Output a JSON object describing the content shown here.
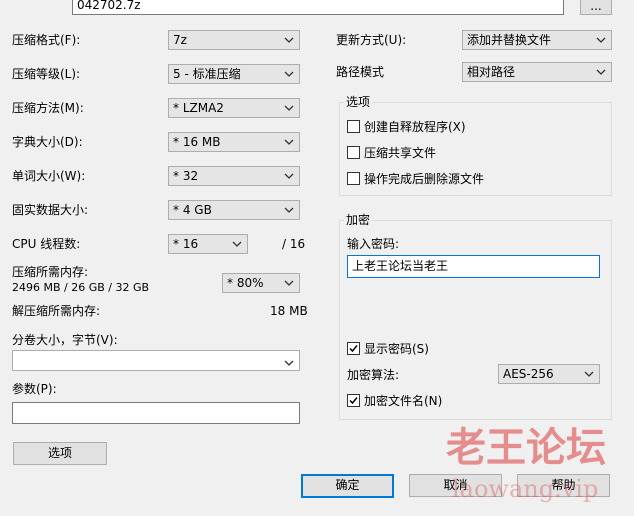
{
  "archive": {
    "path_value": "042702.7z",
    "browse_label": "..."
  },
  "left": {
    "format_label": "压缩格式(F):",
    "format_value": "7z",
    "level_label": "压缩等级(L):",
    "level_value": "5 - 标准压缩",
    "method_label": "压缩方法(M):",
    "method_value": "* LZMA2",
    "dict_label": "字典大小(D):",
    "dict_value": "* 16 MB",
    "word_label": "单词大小(W):",
    "word_value": "* 32",
    "solid_label": "固实数据大小:",
    "solid_value": "* 4 GB",
    "threads_label": "CPU 线程数:",
    "threads_value": "* 16",
    "threads_total": "/ 16",
    "mem_comp_label": "压缩所需内存:",
    "mem_comp_detail": "2496 MB / 26 GB / 32 GB",
    "mem_percent_value": "* 80%",
    "mem_decomp_label": "解压缩所需内存:",
    "mem_decomp_value": "18 MB",
    "split_label": "分卷大小，字节(V):",
    "split_value": "",
    "params_label": "参数(P):",
    "params_value": "",
    "options_button": "选项"
  },
  "right": {
    "update_label": "更新方式(U):",
    "update_value": "添加并替换文件",
    "pathmode_label": "路径模式",
    "pathmode_value": "相对路径",
    "options_group": "选项",
    "opt_sfx": "创建自释放程序(X)",
    "opt_shared": "压缩共享文件",
    "opt_delete": "操作完成后删除源文件",
    "enc_group": "加密",
    "password_label": "输入密码:",
    "password_value": "上老王论坛当老王",
    "show_password": "显示密码(S)",
    "enc_method_label": "加密算法:",
    "enc_method_value": "AES-256",
    "enc_names": "加密文件名(N)"
  },
  "checks": {
    "sfx": false,
    "shared": false,
    "delete": false,
    "show_password": true,
    "enc_names": true
  },
  "buttons": {
    "ok": "确定",
    "cancel": "取消",
    "help": "帮助"
  },
  "watermark": {
    "line1": "老王论坛",
    "line2": "laowang.vip"
  },
  "colors": {
    "focus_blue": "#0078d7",
    "watermark_red": "#dc3c3c"
  }
}
